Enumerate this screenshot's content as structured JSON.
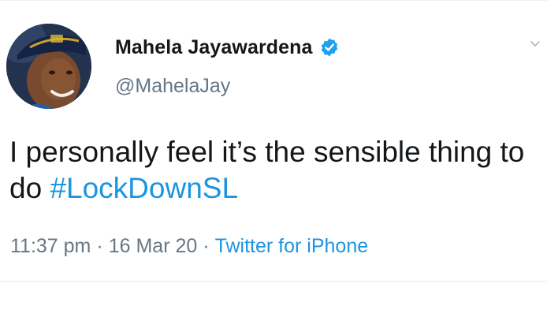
{
  "tweet": {
    "author": {
      "display_name": "Mahela Jayawardena",
      "handle": "@MahelaJay",
      "verified": true
    },
    "text_plain": "I personally feel it’s the sensible thing to do ",
    "hashtag": "#LockDownSL",
    "time": "11:37 pm",
    "date": "16 Mar 20",
    "separator": "·",
    "source": "Twitter for iPhone"
  },
  "colors": {
    "text": "#14171a",
    "secondary": "#657786",
    "link": "#1b95e0",
    "verified": "#1da1f2"
  },
  "icons": {
    "verified": "verified-badge-icon",
    "menu": "chevron-down-icon"
  }
}
